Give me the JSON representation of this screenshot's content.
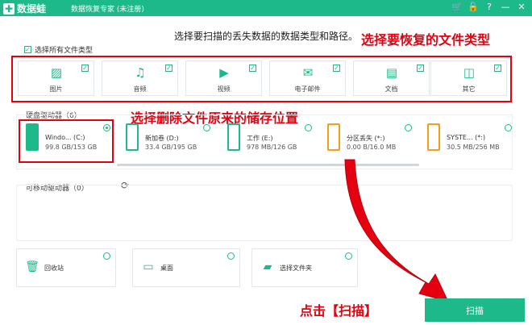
{
  "app": {
    "logo_text": "数据蛙",
    "title": "数据恢复专家 (未注册)"
  },
  "window_controls": [
    "🛒",
    "🔓",
    "?",
    "—",
    "✕"
  ],
  "prompt": "选择要扫描的丢失数据的数据类型和路径。",
  "annotations": {
    "file_types": "选择要恢复的文件类型",
    "location": "选择删除文件原来的储存位置",
    "click_scan": "点击【扫描】"
  },
  "select_all_label": "选择所有文件类型",
  "file_types": [
    {
      "label": "图片",
      "icon": "image-icon",
      "glyph": "▨"
    },
    {
      "label": "音频",
      "icon": "music-icon",
      "glyph": "♫"
    },
    {
      "label": "视频",
      "icon": "video-icon",
      "glyph": "▶"
    },
    {
      "label": "电子邮件",
      "icon": "email-icon",
      "glyph": "✉"
    },
    {
      "label": "文档",
      "icon": "document-icon",
      "glyph": "▤"
    },
    {
      "label": "其它",
      "icon": "other-icon",
      "glyph": "◫"
    }
  ],
  "hard_drives_label": "硬盘驱动器（6）",
  "drives": [
    {
      "name": "Windo... (C:)",
      "size": "99.8 GB/153 GB",
      "selected": true
    },
    {
      "name": "新加卷 (D:)",
      "size": "33.4 GB/195 GB",
      "selected": false
    },
    {
      "name": "工作 (E:)",
      "size": "978 MB/126 GB",
      "selected": false
    },
    {
      "name": "分区丢失 (*:)",
      "size": "0.00  B/16.0 MB",
      "selected": false
    },
    {
      "name": "SYSTE... (*:)",
      "size": "30.5 MB/256 MB",
      "selected": false
    }
  ],
  "removable_label": "可移动驱动器（0）",
  "locations": [
    {
      "label": "回收站",
      "icon": "recycle-bin-icon",
      "glyph": "🗑"
    },
    {
      "label": "桌面",
      "icon": "desktop-icon",
      "glyph": "▭"
    },
    {
      "label": "选择文件夹",
      "icon": "folder-icon",
      "glyph": "▰"
    }
  ],
  "scan_label": "扫描",
  "colors": {
    "accent": "#1db98a",
    "annotation": "#e4000f",
    "warning": "#f59d1c"
  }
}
